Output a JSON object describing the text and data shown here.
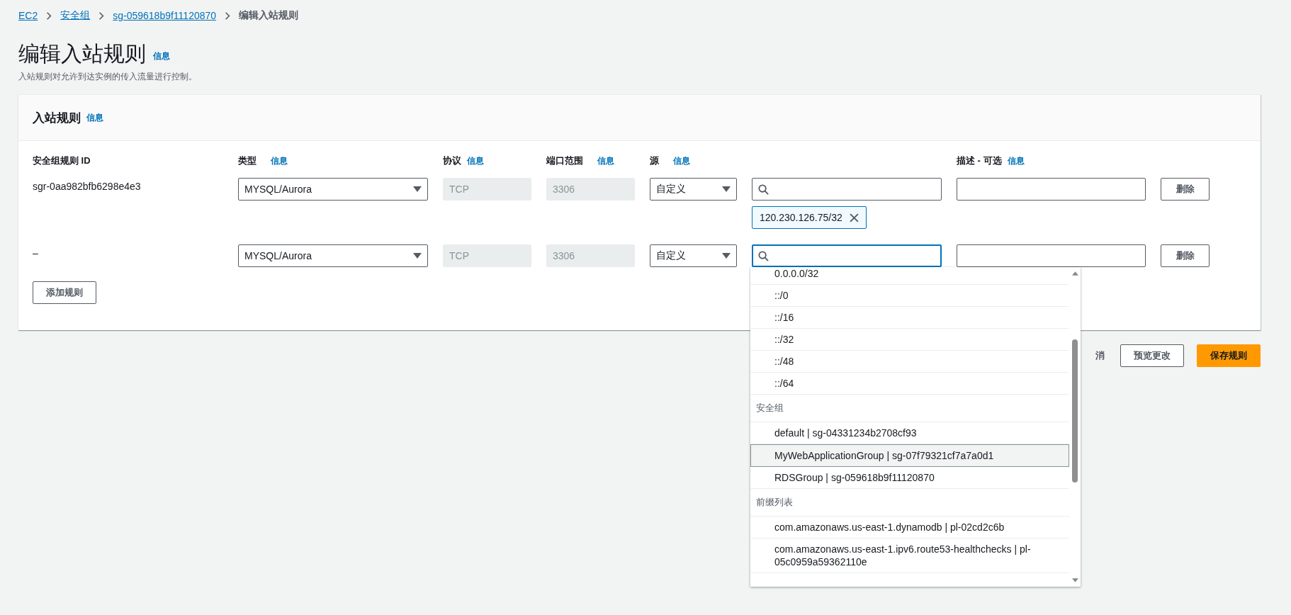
{
  "breadcrumb": [
    {
      "label": "EC2",
      "kind": "link"
    },
    {
      "label": "安全组",
      "kind": "link"
    },
    {
      "label": "sg-059618b9f11120870",
      "kind": "link"
    },
    {
      "label": "编辑入站规则",
      "kind": "current"
    }
  ],
  "page": {
    "title": "编辑入站规则",
    "info": "信息",
    "description": "入站规则对允许到达实例的传入流量进行控制。"
  },
  "panel": {
    "title": "入站规则",
    "info": "信息",
    "columns": [
      {
        "label": "安全组规则 ID"
      },
      {
        "label": "类型",
        "info": "信息"
      },
      {
        "label": "协议",
        "info": "信息"
      },
      {
        "label": "端口范围",
        "info": "信息"
      },
      {
        "label": "源",
        "info": "信息"
      },
      {
        "label": "描述 - 可选",
        "info": "信息"
      }
    ],
    "rules": [
      {
        "id": "sgr-0aa982bfb6298e4e3",
        "type": "MYSQL/Aurora",
        "protocol": "TCP",
        "port": "3306",
        "source_type": "自定义",
        "focused": false,
        "tags": [
          "120.230.126.75/32"
        ],
        "delete": "删除"
      },
      {
        "id": "–",
        "type": "MYSQL/Aurora",
        "protocol": "TCP",
        "port": "3306",
        "source_type": "自定义",
        "focused": true,
        "delete": "删除"
      }
    ],
    "add_button": "添加规则"
  },
  "dropdown": {
    "items": [
      {
        "kind": "option",
        "label": "0.0.0.0/32",
        "selected": false
      },
      {
        "kind": "option",
        "label": "::/0",
        "selected": false
      },
      {
        "kind": "option",
        "label": "::/16",
        "selected": false
      },
      {
        "kind": "option",
        "label": "::/32",
        "selected": false
      },
      {
        "kind": "option",
        "label": "::/48",
        "selected": false
      },
      {
        "kind": "option",
        "label": "::/64",
        "selected": false
      },
      {
        "kind": "group",
        "label": "安全组"
      },
      {
        "kind": "option",
        "label": "default | sg-04331234b2708cf93",
        "selected": false
      },
      {
        "kind": "option",
        "label": "MyWebApplicationGroup | sg-07f79321cf7a7a0d1",
        "selected": true
      },
      {
        "kind": "option",
        "label": "RDSGroup | sg-059618b9f11120870",
        "selected": false
      },
      {
        "kind": "group",
        "label": "前缀列表"
      },
      {
        "kind": "option",
        "label": "com.amazonaws.us-east-1.dynamodb | pl-02cd2c6b",
        "selected": false
      },
      {
        "kind": "option",
        "label": "com.amazonaws.us-east-1.ipv6.route53-healthchecks | pl-05c0959a59362110e",
        "selected": false
      }
    ]
  },
  "actions": {
    "cancel": "消",
    "preview": "预览更改",
    "save": "保存规则"
  }
}
